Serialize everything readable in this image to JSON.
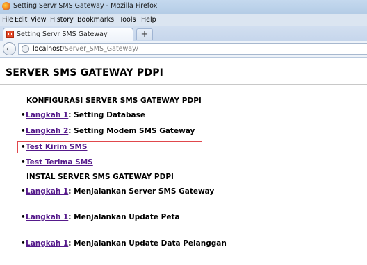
{
  "window": {
    "title": "Setting Servr SMS Gateway - Mozilla Firefox"
  },
  "menu": {
    "file": "File",
    "edit": "Edit",
    "view": "View",
    "history": "History",
    "bookmarks": "Bookmarks",
    "tools": "Tools",
    "help": "Help"
  },
  "tab": {
    "label": "Setting Servr SMS Gateway",
    "new_tab": "+"
  },
  "nav": {
    "back": "←",
    "url_host": "localhost",
    "url_path": "/Server_SMS_Gateway/"
  },
  "page": {
    "title": "SERVER SMS GATEWAY PDPI",
    "section_config": "KONFIGURASI SERVER SMS GATEWAY PDPI",
    "section_install": "INSTAL SERVER SMS GATEWAY PDPI",
    "bullet": "•",
    "items": [
      {
        "link": "Langkah 1",
        "text": ": Setting Database"
      },
      {
        "link": "Langkah 2",
        "text": ": Setting Modem SMS Gateway"
      },
      {
        "link": "Test Kirim SMS",
        "text": ""
      },
      {
        "link": "Test Terima SMS",
        "text": ""
      },
      {
        "link": "Langkah 1",
        "text": ": Menjalankan Server SMS Gateway"
      },
      {
        "link": "Langkah 1",
        "text": ": Menjalankan Update Peta"
      },
      {
        "link": "Langkah 1",
        "text": ": Menjalankan Update Data Pelanggan"
      }
    ]
  },
  "colors": {
    "visited_link": "#551a8b",
    "highlight_border": "#e0474c"
  },
  "icons": {
    "app": "firefox-icon",
    "tab": "favicon-icon",
    "back": "back-arrow-icon",
    "site": "globe-icon"
  }
}
